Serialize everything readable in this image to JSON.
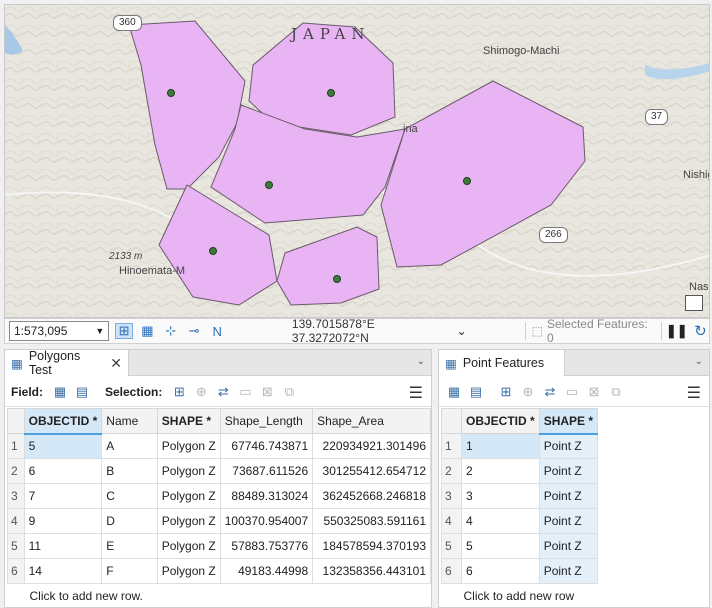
{
  "map": {
    "country_label": "JAPAN",
    "places": [
      "Shimogo-Machi",
      "Nishig",
      "Hinoemata-M",
      "Nasu",
      "ina"
    ],
    "elevation_label": "2133 m",
    "road_shields": [
      "360",
      "37",
      "266"
    ],
    "colors": {
      "polygon_fill": "#e8b4f4",
      "polygon_stroke": "#6a5a6a",
      "point_fill": "#3d7a3d",
      "terrain": "#e8e6df"
    }
  },
  "statusbar": {
    "scale": "1:573,095",
    "coordinates": "139.7015878°E 37.3272072°N",
    "selected_features": "Selected Features: 0",
    "icons": [
      "zoom-tools-icon",
      "grid-icon",
      "snapping-icon",
      "constraints-icon",
      "north-arrow-icon",
      "pause-icon",
      "refresh-icon"
    ]
  },
  "left_pane": {
    "tab_title": "Polygons Test",
    "field_label": "Field:",
    "selection_label": "Selection:",
    "columns": [
      "OBJECTID *",
      "Name",
      "SHAPE *",
      "Shape_Length",
      "Shape_Area"
    ],
    "rows": [
      [
        "1",
        "5",
        "A",
        "Polygon Z",
        "67746.743871",
        "220934921.301496"
      ],
      [
        "2",
        "6",
        "B",
        "Polygon Z",
        "73687.611526",
        "301255412.654712"
      ],
      [
        "3",
        "7",
        "C",
        "Polygon Z",
        "88489.313024",
        "362452668.246818"
      ],
      [
        "4",
        "9",
        "D",
        "Polygon Z",
        "100370.954007",
        "550325083.591161"
      ],
      [
        "5",
        "11",
        "E",
        "Polygon Z",
        "57883.753776",
        "184578594.370193"
      ],
      [
        "6",
        "14",
        "F",
        "Polygon Z",
        "49183.44998",
        "132358356.443101"
      ]
    ],
    "add_row": "Click to add new row."
  },
  "right_pane": {
    "tab_title": "Point Features",
    "columns": [
      "OBJECTID *",
      "SHAPE *"
    ],
    "rows": [
      [
        "1",
        "1",
        "Point Z"
      ],
      [
        "2",
        "2",
        "Point Z"
      ],
      [
        "3",
        "3",
        "Point Z"
      ],
      [
        "4",
        "4",
        "Point Z"
      ],
      [
        "5",
        "5",
        "Point Z"
      ],
      [
        "6",
        "6",
        "Point Z"
      ]
    ],
    "add_row": "Click to add new row"
  }
}
